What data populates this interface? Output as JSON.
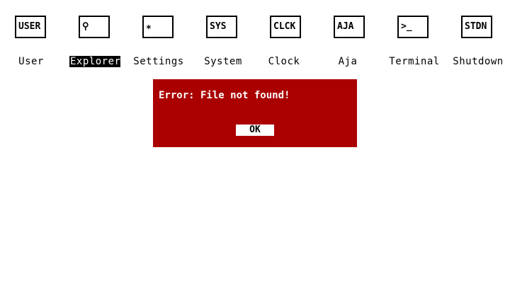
{
  "colors": {
    "desktop_background": "#ffffff",
    "icon_border": "#000000",
    "selected_label_background": "#000000",
    "selected_label_text": "#ffffff",
    "dialog_background": "#aa0000",
    "dialog_text": "#ffffff",
    "button_background": "#ffffff",
    "button_text": "#000000"
  },
  "desktop": {
    "icons": [
      {
        "glyph": "USER",
        "label": "User",
        "icon_name": "user-icon",
        "selected": false
      },
      {
        "glyph": "⚲",
        "label": "Explorer",
        "icon_name": "magnifier-icon",
        "selected": true
      },
      {
        "glyph": "*",
        "label": "Settings",
        "icon_name": "gear-icon",
        "selected": false
      },
      {
        "glyph": "SYS",
        "label": "System",
        "icon_name": "system-icon",
        "selected": false
      },
      {
        "glyph": "CLCK",
        "label": "Clock",
        "icon_name": "clock-icon",
        "selected": false
      },
      {
        "glyph": "AJA",
        "label": "Aja",
        "icon_name": "aja-icon",
        "selected": false
      },
      {
        "glyph": ">_",
        "label": "Terminal",
        "icon_name": "terminal-icon",
        "selected": false
      },
      {
        "glyph": "STDN",
        "label": "Shutdown",
        "icon_name": "power-icon",
        "selected": false
      }
    ]
  },
  "dialog": {
    "message": "Error: File not found!",
    "ok_label": "OK"
  }
}
